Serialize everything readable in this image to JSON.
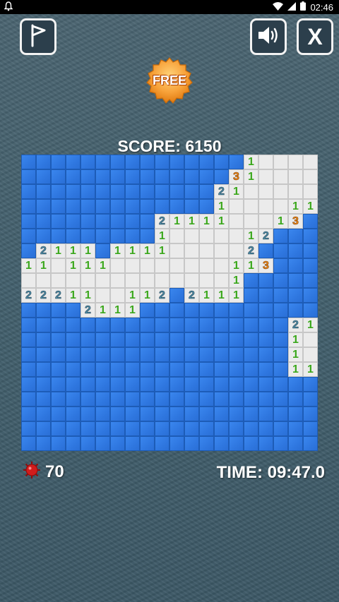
{
  "status_bar": {
    "time": "02:46",
    "icons": [
      "notification-bell-icon",
      "wifi-icon",
      "signal-icon",
      "battery-icon"
    ]
  },
  "toolbar": {
    "flag_icon": "flag-icon",
    "sound_icon": "speaker-icon",
    "close_label": "X"
  },
  "badge": {
    "label": "FREE"
  },
  "score": {
    "text": "SCORE: 6150"
  },
  "board": {
    "size": 20,
    "legend": "H = hidden tile, . = revealed empty tile, digit = revealed number",
    "rows": [
      "HHHHHHHHHHHHHHH1....",
      "HHHHHHHHHHHHHH31....",
      "HHHHHHHHHHHHH21.....",
      "HHHHHHHHHHHHH1....11",
      "HHHHHHHHH21111...13H",
      "HHHHHHHHH1.....12HHH",
      "H2111H1111.....2HHHH",
      "11.111........113HHH",
      "..............1HHHHH",
      "22211..112H2111HHHHH",
      "HHHH2111HHHHHHHHHHHH",
      "HHHHHHHHHHHHHHHHHH21",
      "HHHHHHHHHHHHHHHHHH1.",
      "HHHHHHHHHHHHHHHHHH1.",
      "HHHHHHHHHHHHHHHHHH11",
      "HHHHHHHHHHHHHHHHHHHH",
      "HHHHHHHHHHHHHHHHHHHH",
      "HHHHHHHHHHHHHHHHHHHH",
      "HHHHHHHHHHHHHHHHHHHH",
      "HHHHHHHHHHHHHHHHHHHH"
    ],
    "colors": {
      "hidden": "#2f77e0",
      "revealed": "#ebebeb",
      "n1": "#3aa61b",
      "n2": "#4f8ea8",
      "n3": "#f08a18"
    }
  },
  "footer": {
    "mine_icon": "mine-icon",
    "mines_left": "70",
    "time_text": "TIME: 09:47.0"
  }
}
